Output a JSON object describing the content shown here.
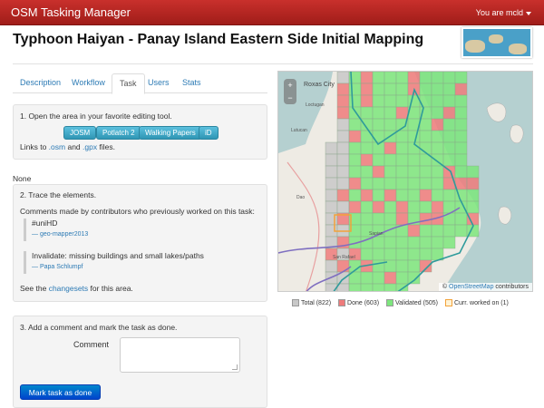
{
  "navbar": {
    "brand": "OSM Tasking Manager",
    "user": "You are mcld"
  },
  "project": {
    "title": "Typhoon Haiyan - Panay Island Eastern Side Initial Mapping"
  },
  "tabs": [
    {
      "label": "Description",
      "active": false
    },
    {
      "label": "Workflow",
      "active": false
    },
    {
      "label": "Task",
      "active": true
    },
    {
      "label": "Users",
      "active": false
    },
    {
      "label": "Stats",
      "active": false
    }
  ],
  "step1": {
    "heading": "1. Open the area in your favorite editing tool.",
    "editors": [
      "JOSM",
      "Potlatch 2",
      "Walking Papers",
      "iD"
    ],
    "links_prefix": "Links to",
    "link_osm": ".osm",
    "link_and": "and",
    "link_gpx": ".gpx",
    "links_suffix": "files."
  },
  "none_label": "None",
  "step2": {
    "heading": "2. Trace the elements.",
    "comments_intro": "Comments made by contributors who previously worked on this task:",
    "comments": [
      {
        "text": "#uniHD",
        "author": "— geo-mapper2013"
      },
      {
        "text": "Invalidate: missing buildings and small lakes/paths",
        "author": "— Papa Schlumpf"
      }
    ],
    "see_prefix": "See the",
    "see_link": "changesets",
    "see_suffix": "for this area."
  },
  "step3": {
    "heading": "3. Add a comment and mark the task as done.",
    "comment_label": "Comment",
    "comment_value": "",
    "submit": "Mark task as done"
  },
  "map": {
    "zoom_in": "+",
    "zoom_out": "−",
    "city_label": "Roxas City",
    "place_labels": [
      "Loctugan",
      "Lutucan",
      "San Rafael",
      "Sapian",
      "Dao"
    ],
    "attribution_prefix": "©",
    "attribution_link": "OpenStreetMap",
    "attribution_suffix": "contributors",
    "colors": {
      "done": "#ee7b7b",
      "validated": "#7de67d",
      "total": "#c8c8c8",
      "current": "#f2a23a",
      "boundary": "#3aa0a0"
    }
  },
  "legend": [
    {
      "label": "Total (822)",
      "color": "#c8c8c8"
    },
    {
      "label": "Done (603)",
      "color": "#ee7b7b"
    },
    {
      "label": "Validated (505)",
      "color": "#7de67d"
    },
    {
      "label": "Curr. worked on (1)",
      "color": "#fff3d6"
    }
  ]
}
